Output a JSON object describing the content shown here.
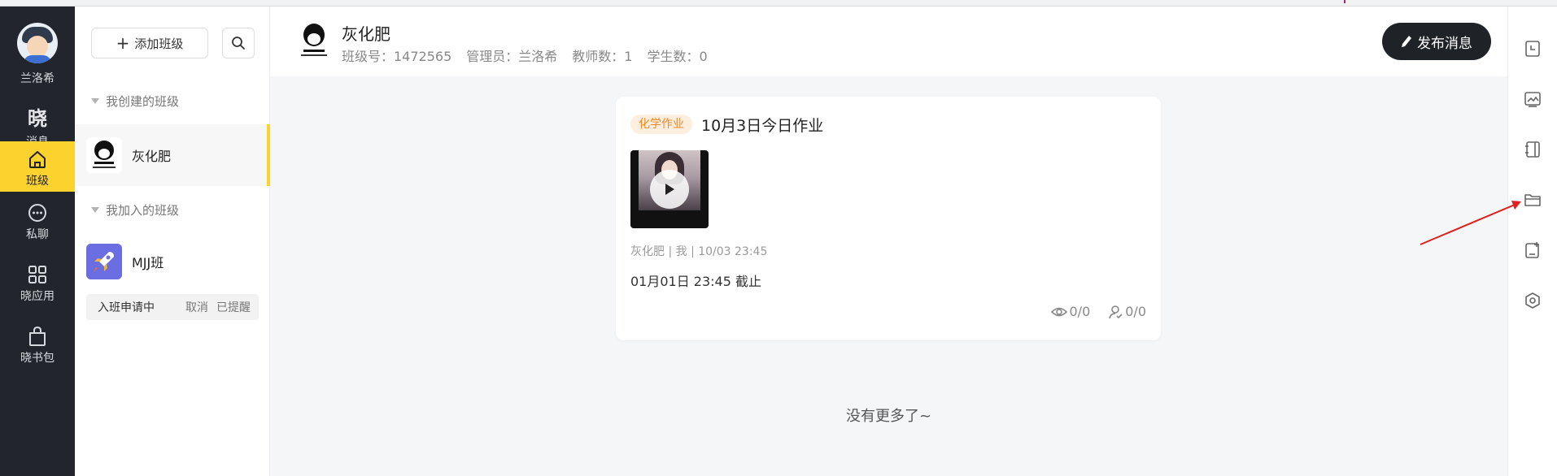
{
  "user": {
    "name": "兰洛希"
  },
  "nav": {
    "logo_glyph": "晓",
    "items": [
      {
        "label": "消息"
      },
      {
        "label": "班级"
      },
      {
        "label": "私聊"
      },
      {
        "label": "晓应用"
      },
      {
        "label": "晓书包"
      }
    ]
  },
  "classpanel": {
    "add_button_label": "添加班级",
    "created_section": "我创建的班级",
    "joined_section": "我加入的班级",
    "created_classes": [
      {
        "name": "灰化肥"
      }
    ],
    "joined_classes": [
      {
        "name": "MJJ班"
      }
    ],
    "join_request": {
      "status": "入班申请中",
      "cancel": "取消",
      "reminded": "已提醒"
    }
  },
  "header": {
    "title": "灰化肥",
    "class_id": "班级号：1472565",
    "admin": "管理员：兰洛希",
    "teachers": "教师数：1",
    "students": "学生数：0",
    "publish_label": "发布消息"
  },
  "post": {
    "tag": "化学作业",
    "title": "10月3日今日作业",
    "meta": "灰化肥 | 我 | 10/03 23:45",
    "deadline": "01月01日 23:45 截止",
    "views": "0/0",
    "completions": "0/0"
  },
  "footer_text": "没有更多了~",
  "right_tools": [
    "clock-doc-icon",
    "image-icon",
    "notebook-icon",
    "folder-icon",
    "add-doc-icon",
    "settings-hex-icon"
  ],
  "colors": {
    "accent": "#fbd22e",
    "nav_bg": "#22252b",
    "tag_text": "#f08a24",
    "tag_bg": "#fdeee0",
    "annotation": "#e02020"
  }
}
